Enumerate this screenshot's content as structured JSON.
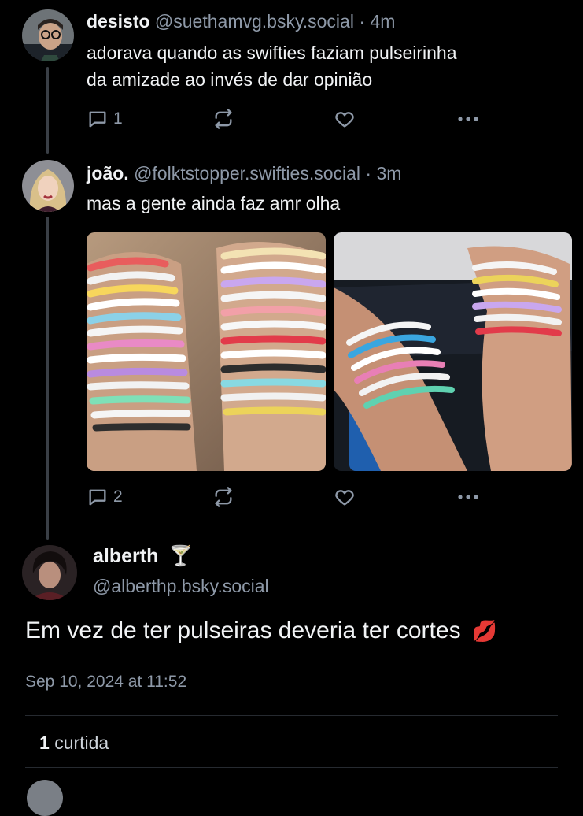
{
  "posts": [
    {
      "display_name": "desisto",
      "handle": "@suethamvg.bsky.social",
      "separator": "·",
      "time": "4m",
      "text_lines": [
        "adorava quando as swifties faziam pulseirinha",
        "da amizade ao invés de dar opinião"
      ],
      "reply_count": "1",
      "avatar_icon": "avatar-person-glasses"
    },
    {
      "display_name": "joão.",
      "handle": "@folktstopper.swifties.social",
      "separator": "·",
      "time": "3m",
      "text_lines": [
        "mas a gente ainda faz amr olha"
      ],
      "reply_count": "2",
      "avatar_icon": "avatar-blonde-woman",
      "images": [
        "photo-friendship-bracelets-stacked-wrists",
        "photo-friendship-bracelets-two-wrists"
      ]
    }
  ],
  "main_post": {
    "display_name": "alberth",
    "name_emoji": "🍸",
    "handle": "@alberthp.bsky.social",
    "text": "Em vez de ter pulseiras deveria ter cortes",
    "text_emoji": "💋",
    "timestamp": "Sep 10, 2024 at 11:52",
    "likes_count": "1",
    "likes_label": "curtida",
    "avatar_icon": "avatar-dark-hair-person"
  },
  "colors": {
    "background": "#000000",
    "text_primary": "#f1f3f5",
    "text_secondary": "#8e99a8",
    "thread_line": "#3a3f46"
  }
}
